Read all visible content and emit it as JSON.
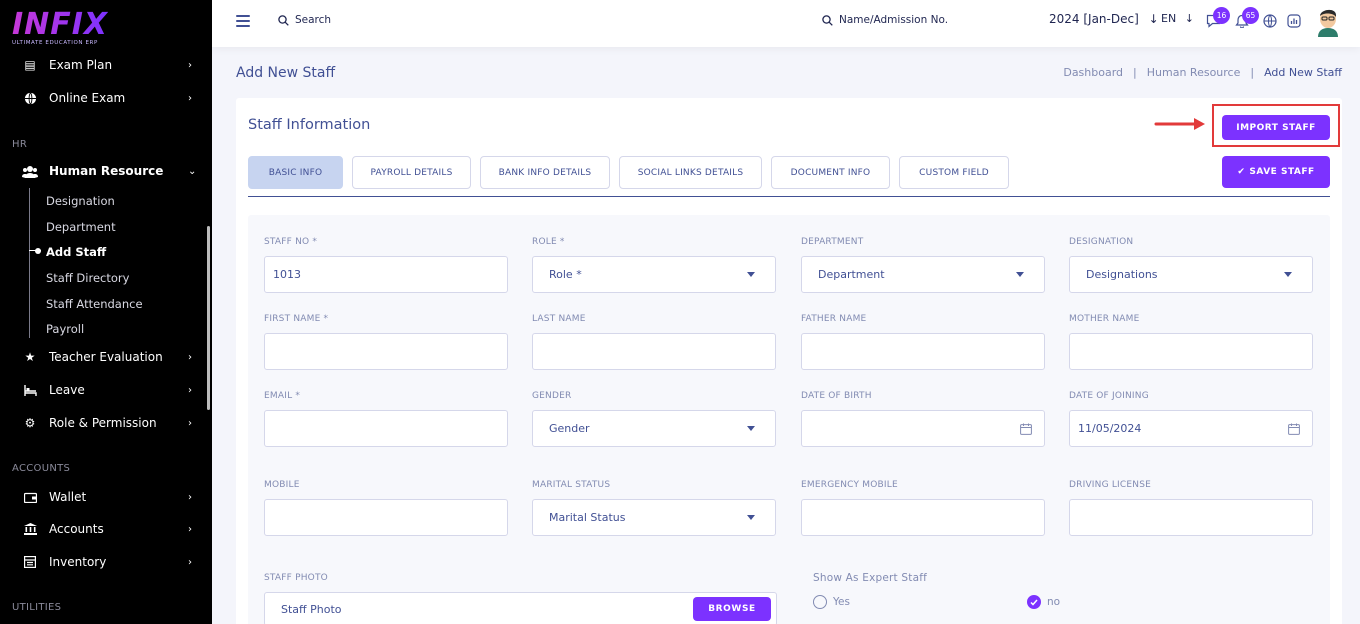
{
  "brand": {
    "logo": "INFIX",
    "tagline": "ULTIMATE EDUCATION ERP"
  },
  "sidebar": {
    "top_items": [
      {
        "label": "Exam Plan",
        "icon": "clipboard-icon"
      },
      {
        "label": "Online Exam",
        "icon": "globe-icon"
      }
    ],
    "sections": {
      "hr": "HR",
      "accounts": "ACCOUNTS",
      "utilities": "UTILITIES"
    },
    "human_resource": {
      "label": "Human Resource",
      "icon": "users-icon",
      "sub_items": [
        "Designation",
        "Department",
        "Add Staff",
        "Staff Directory",
        "Staff Attendance",
        "Payroll"
      ],
      "active": "Add Staff"
    },
    "hr_items": [
      {
        "label": "Teacher Evaluation",
        "icon": "star-icon"
      },
      {
        "label": "Leave",
        "icon": "bed-icon"
      },
      {
        "label": "Role & Permission",
        "icon": "gear-icon"
      }
    ],
    "accounts_items": [
      {
        "label": "Wallet",
        "icon": "wallet-icon"
      },
      {
        "label": "Accounts",
        "icon": "bank-icon"
      },
      {
        "label": "Inventory",
        "icon": "inventory-icon"
      }
    ]
  },
  "topbar": {
    "search_label": "Search",
    "admission_search_label": "Name/Admission No.",
    "academic_year": "2024 [Jan-Dec]",
    "language": "EN",
    "message_count": "16",
    "notification_count": "65"
  },
  "page": {
    "title": "Add New Staff",
    "breadcrumb": [
      "Dashboard",
      "Human Resource",
      "Add New Staff"
    ]
  },
  "card": {
    "title": "Staff Information",
    "import_button": "IMPORT STAFF",
    "save_button": "SAVE STAFF",
    "tabs": [
      "BASIC INFO",
      "PAYROLL DETAILS",
      "BANK INFO DETAILS",
      "SOCIAL LINKS DETAILS",
      "DOCUMENT INFO",
      "CUSTOM FIELD"
    ],
    "active_tab": "BASIC INFO"
  },
  "form": {
    "staff_no": {
      "label": "STAFF NO *",
      "value": "1013"
    },
    "role": {
      "label": "ROLE *",
      "value": "Role *"
    },
    "department": {
      "label": "DEPARTMENT",
      "value": "Department"
    },
    "designation": {
      "label": "DESIGNATION",
      "value": "Designations"
    },
    "first_name": {
      "label": "FIRST NAME *",
      "value": ""
    },
    "last_name": {
      "label": "LAST NAME",
      "value": ""
    },
    "father_name": {
      "label": "FATHER NAME",
      "value": ""
    },
    "mother_name": {
      "label": "MOTHER NAME",
      "value": ""
    },
    "email": {
      "label": "EMAIL *",
      "value": ""
    },
    "gender": {
      "label": "GENDER",
      "value": "Gender"
    },
    "date_of_birth": {
      "label": "DATE OF BIRTH",
      "value": ""
    },
    "date_of_joining": {
      "label": "DATE OF JOINING",
      "value": "11/05/2024"
    },
    "mobile": {
      "label": "MOBILE",
      "value": ""
    },
    "marital_status": {
      "label": "MARITAL STATUS",
      "value": "Marital Status"
    },
    "emergency_mobile": {
      "label": "EMERGENCY MOBILE",
      "value": ""
    },
    "driving_license": {
      "label": "DRIVING LICENSE",
      "value": ""
    },
    "staff_photo": {
      "label": "STAFF PHOTO",
      "placeholder": "Staff Photo",
      "button": "BROWSE"
    },
    "expert_staff": {
      "label": "Show As Expert Staff",
      "options": [
        "Yes",
        "no"
      ],
      "selected": "no"
    }
  },
  "colors": {
    "primary": "#7c32ff",
    "text": "#415094",
    "highlight": "#e23a3a",
    "tab_active": "#c7d4f0"
  }
}
